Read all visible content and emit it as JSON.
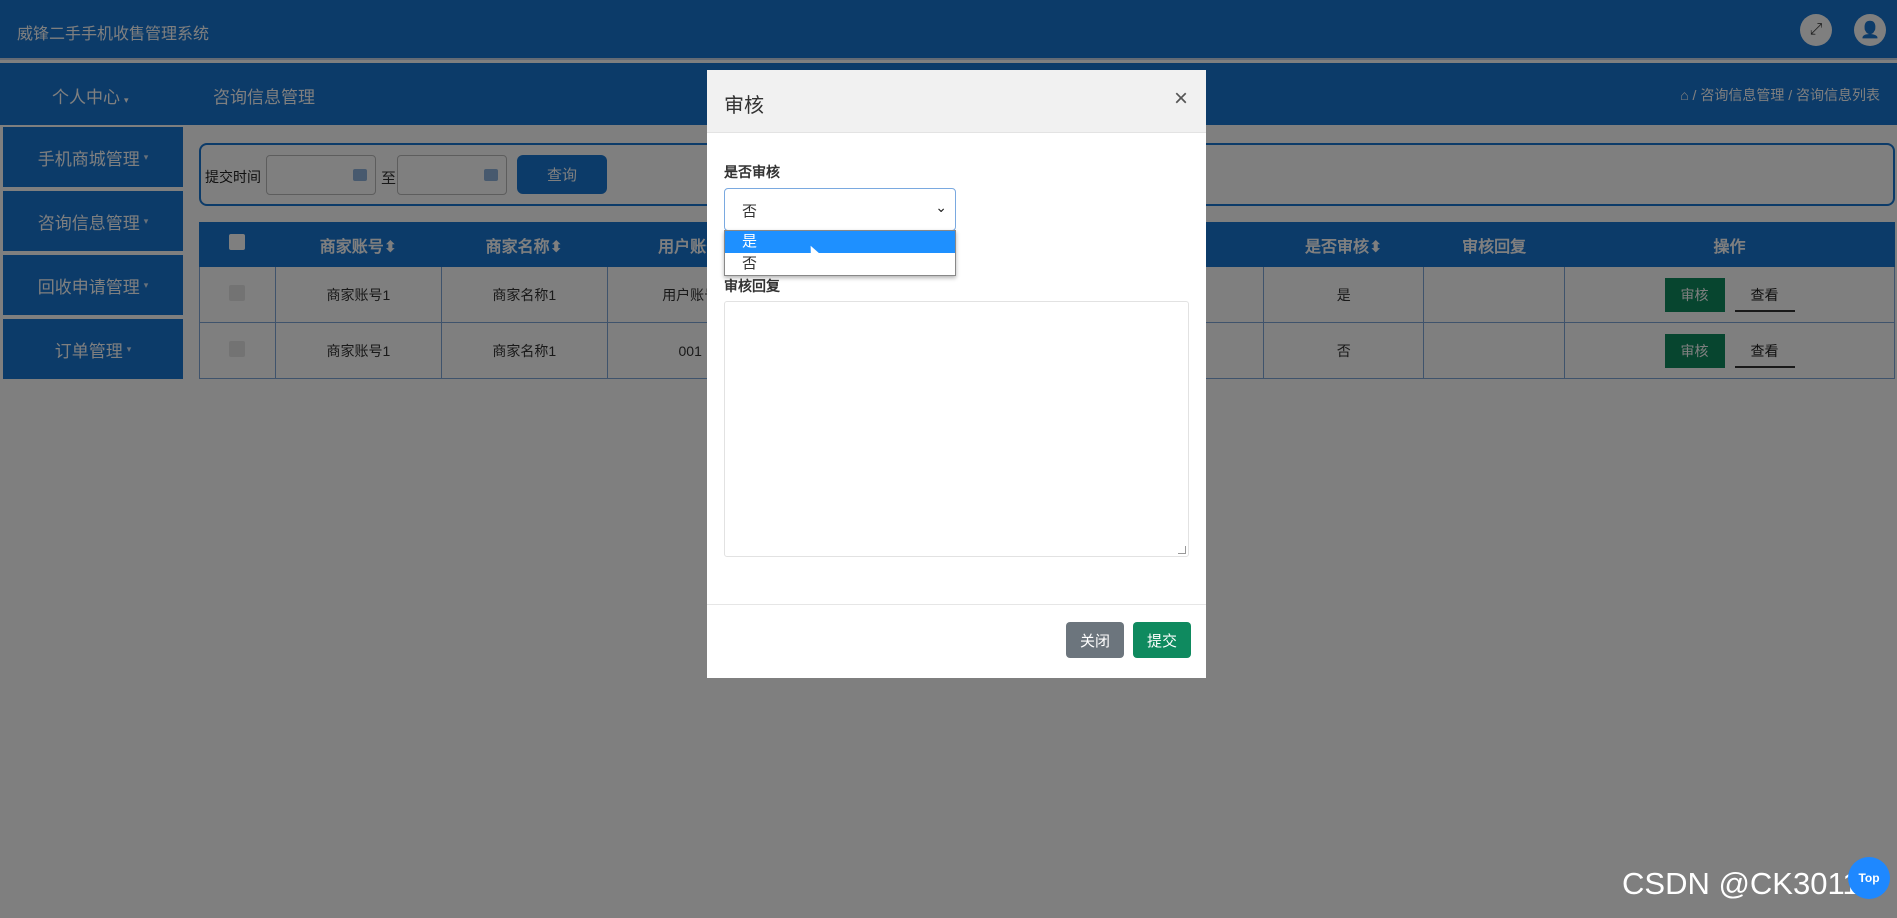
{
  "app": {
    "title": "威锋二手手机收售管理系统"
  },
  "topbar": {
    "icons": [
      "fullscreen-icon",
      "user-icon"
    ]
  },
  "navbar": {
    "personal": "个人中心",
    "current": "咨询信息管理",
    "breadcrumb": "/ 咨询信息管理 / 咨询信息列表"
  },
  "sidebar": {
    "items": [
      {
        "label": "手机商城管理"
      },
      {
        "label": "咨询信息管理"
      },
      {
        "label": "回收申请管理"
      },
      {
        "label": "订单管理"
      }
    ]
  },
  "search": {
    "label": "提交时间",
    "to": "至",
    "button": "查询"
  },
  "table": {
    "headers": {
      "merchant_account": "商家账号",
      "merchant_name": "商家名称",
      "user_account": "用户账号",
      "audited": "是否审核",
      "reply": "审核回复",
      "actions": "操作"
    },
    "rows": [
      {
        "merchant_account": "商家账号1",
        "merchant_name": "商家名称1",
        "user_account": "用户账号",
        "audited": "是",
        "reply": ""
      },
      {
        "merchant_account": "商家账号1",
        "merchant_name": "商家名称1",
        "user_account": "001",
        "audited": "否",
        "reply": ""
      }
    ],
    "audit_btn": "审核",
    "view_btn": "查看"
  },
  "modal": {
    "title": "审核",
    "close_icon": "×",
    "audit_label": "是否审核",
    "audit_value": "否",
    "options": [
      "是",
      "否"
    ],
    "reply_label": "审核回复",
    "reply_value": "",
    "close_btn": "关闭",
    "submit_btn": "提交"
  },
  "watermark": "CSDN @CK3011",
  "top_button": "Top"
}
